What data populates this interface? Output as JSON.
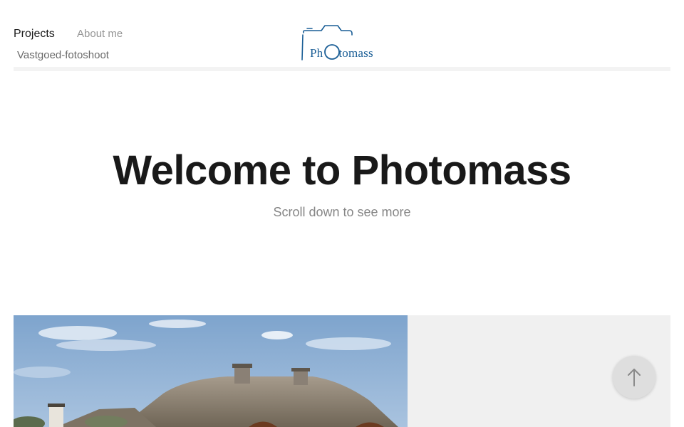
{
  "nav": {
    "projects_label": "Projects",
    "about_label": "About me",
    "sub_item_label": "Vastgoed-fotoshoot"
  },
  "logo": {
    "text_left": "Ph",
    "text_right": "tomass",
    "icon": "camera-icon",
    "color": "#1a5e96"
  },
  "hero": {
    "title": "Welcome to Photomass",
    "subtitle": "Scroll down to see more"
  },
  "project": {
    "image": "house-photo"
  },
  "scroll_top": {
    "icon": "arrow-up-icon"
  }
}
